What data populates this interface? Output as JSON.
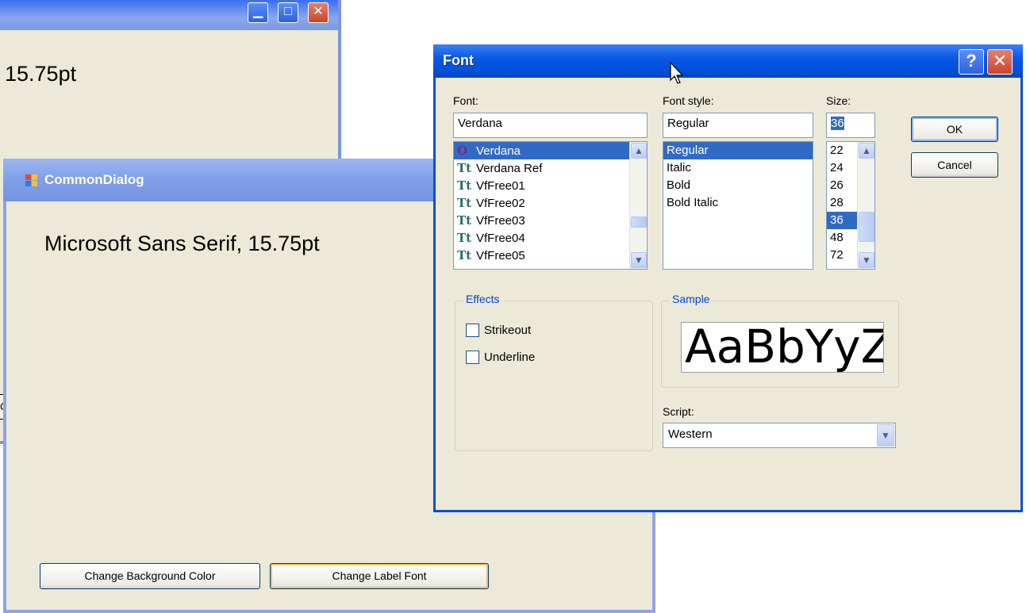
{
  "background_window": {
    "label_text": "15.75pt",
    "partial_button_text": "Cl"
  },
  "common_dialog": {
    "title": "CommonDialog",
    "label_text": "Microsoft Sans Serif, 15.75pt",
    "buttons": {
      "change_background": "Change Background Color",
      "change_font": "Change Label Font"
    }
  },
  "font_dialog": {
    "title": "Font",
    "help_glyph": "?",
    "close_glyph": "✕",
    "font": {
      "caption": "Font:",
      "value": "Verdana",
      "items": [
        "Verdana",
        "Verdana Ref",
        "VfFree01",
        "VfFree02",
        "VfFree03",
        "VfFree04",
        "VfFree05"
      ],
      "item_icons": [
        "opentype-icon",
        "truetype-icon",
        "truetype-icon",
        "truetype-icon",
        "truetype-icon",
        "truetype-icon",
        "truetype-icon"
      ]
    },
    "style": {
      "caption": "Font style:",
      "value": "Regular",
      "items": [
        "Regular",
        "Italic",
        "Bold",
        "Bold Italic"
      ]
    },
    "size": {
      "caption": "Size:",
      "value": "36",
      "items": [
        "22",
        "24",
        "26",
        "28",
        "36",
        "48",
        "72"
      ]
    },
    "ok_label": "OK",
    "cancel_label": "Cancel",
    "effects": {
      "title": "Effects",
      "strikeout": "Strikeout",
      "underline": "Underline",
      "strikeout_checked": false,
      "underline_checked": false
    },
    "sample": {
      "title": "Sample",
      "text": "AaBbYyZz"
    },
    "script": {
      "caption": "Script:",
      "value": "Western"
    }
  },
  "colors": {
    "dialog_bg": "#ece9d8",
    "selection": "#316ac5",
    "xp_title_blue": "#0050d8",
    "group_title": "#0046d5"
  }
}
